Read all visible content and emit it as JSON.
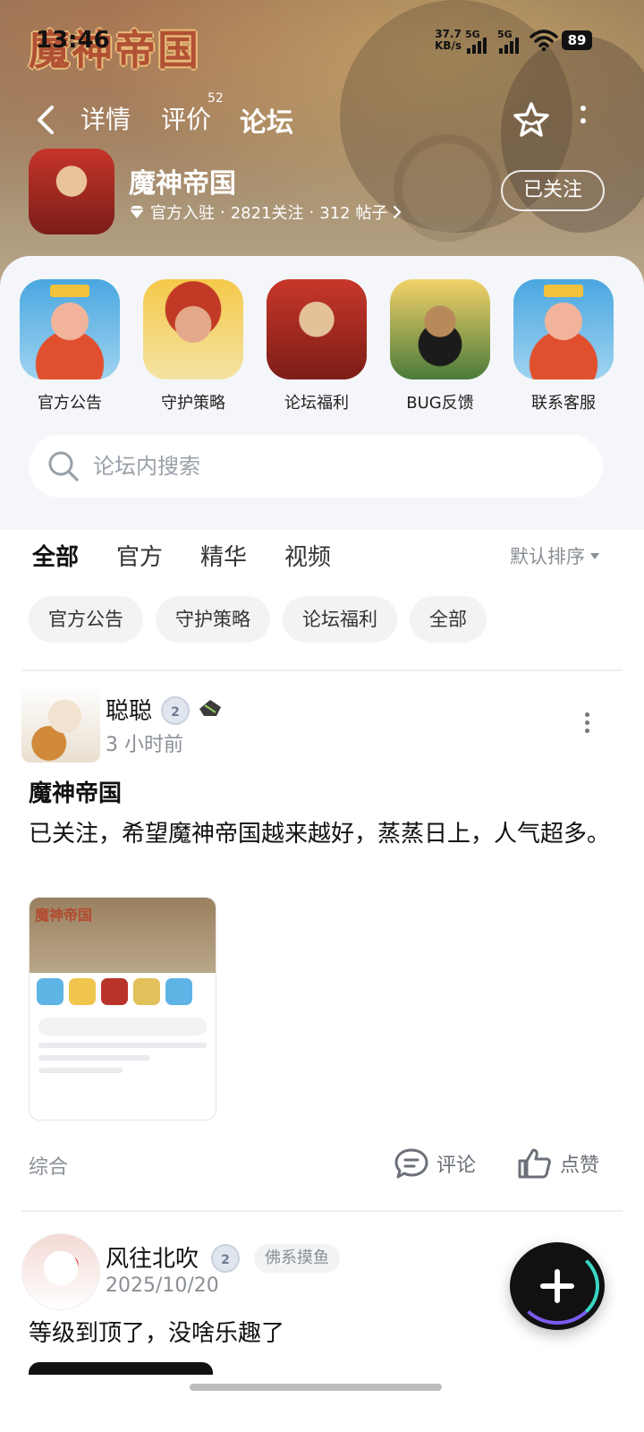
{
  "status_bar": {
    "time": "13:46",
    "net_speed_value": "37.7",
    "net_speed_unit": "KB/s",
    "sim1_label": "5G",
    "sim2_label": "5G",
    "battery": "89"
  },
  "hero": {
    "logo_text": "魔神帝国"
  },
  "nav": {
    "tabs": [
      {
        "label": "详情"
      },
      {
        "label": "评价",
        "count": "52"
      },
      {
        "label": "论坛",
        "active": true
      }
    ],
    "icons": [
      "back-arrow-icon",
      "star-icon",
      "more-vertical-icon"
    ]
  },
  "game": {
    "name": "魔神帝国",
    "official": "官方入驻",
    "followers": "2821关注",
    "posts": "312 帖子",
    "sep": "·",
    "follow_button": "已关注"
  },
  "shortcuts": [
    {
      "label": "官方公告"
    },
    {
      "label": "守护策略"
    },
    {
      "label": "论坛福利"
    },
    {
      "label": "BUG反馈"
    },
    {
      "label": "联系客服"
    }
  ],
  "search": {
    "placeholder": "论坛内搜索"
  },
  "filter_tabs": [
    {
      "label": "全部",
      "active": true
    },
    {
      "label": "官方"
    },
    {
      "label": "精华"
    },
    {
      "label": "视频"
    }
  ],
  "sort_label": "默认排序",
  "chips": [
    "官方公告",
    "守护策略",
    "论坛福利",
    "全部"
  ],
  "posts": [
    {
      "author": "聪聪",
      "level": "2",
      "time": "3 小时前",
      "title": "魔神帝国",
      "body": "已关注，希望魔神帝国越来越好，蒸蒸日上，人气超多。",
      "tag": "综合",
      "comment_label": "评论",
      "like_label": "点赞"
    },
    {
      "author": "风往北吹",
      "level": "2",
      "flair": "佛系摸鱼",
      "time": "2025/10/20",
      "body": "等级到顶了，没啥乐趣了"
    }
  ],
  "colors": {
    "accent": "#3ad6c4",
    "muted": "#8a8f96",
    "chip_bg": "#f2f3f5"
  }
}
